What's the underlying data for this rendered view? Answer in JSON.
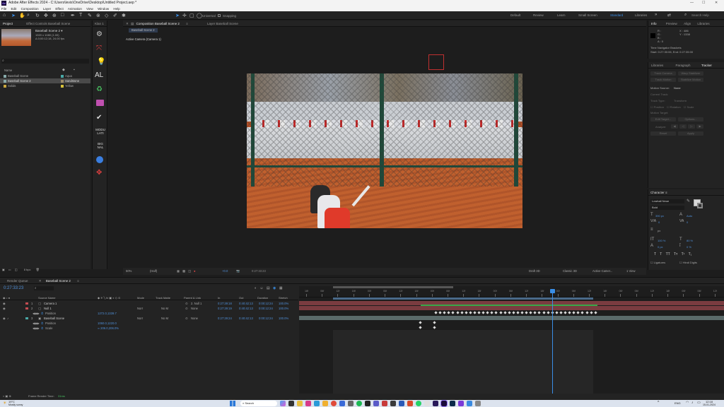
{
  "window": {
    "title": "Adobe After Effects 2024 - C:\\Users\\levis\\OneDrive\\Desktop\\Untitled Project.aep *",
    "app_badge": "Ae"
  },
  "menu": [
    "File",
    "Edit",
    "Composition",
    "Layer",
    "Effect",
    "Animation",
    "View",
    "Window",
    "Help"
  ],
  "toolbar": {
    "universal": "Universal",
    "snapping": "Snapping"
  },
  "workspaces": [
    "Default",
    "Review",
    "Learn",
    "Small Screen",
    "Standard",
    "Libraries"
  ],
  "search_help": "Search Help",
  "project": {
    "tabs": [
      "Project",
      "Effect Controls Baseball Scene"
    ],
    "selected_name": "Baseball Scene 2 ▾",
    "selected_info1": "1920 x 1080 (1.00)",
    "selected_info2": "Δ 0;00:12;18, 24.00 fps",
    "col_name": "Name",
    "items": [
      {
        "name": "Baseball Scene",
        "label": "Aqua",
        "color": "#4aa9a7"
      },
      {
        "name": "Baseball Scene 2",
        "label": "Sandstone",
        "color": "#9a8a6a"
      },
      {
        "name": "Solids",
        "label": "Yellow",
        "color": "#d8c23a"
      }
    ],
    "bpc": "8 bpc"
  },
  "effects_strip": {
    "tab": "Klan 1",
    "text1": "AL",
    "text2": "MODU\nLATI",
    "text3": "BIG\nNAL"
  },
  "composition": {
    "tab_comp": "Composition Baseball Scene 2",
    "tab_layer": "Layer Baseball Scene",
    "breadcrumb": "Baseball Scene 2",
    "camera_label": "Active Camera (Camera 1)",
    "zoom": "50%",
    "resolution": "(Half)",
    "exposure": "+0.0",
    "timecode": "0:27:33:23",
    "draft3d": "Draft 3D",
    "renderer": "Classic 3D",
    "view_camera": "Active Camer...",
    "views": "1 View"
  },
  "info": {
    "tabs": [
      "Info",
      "Preview",
      "Align",
      "Libraries"
    ],
    "r": "R :",
    "g": "G :",
    "b": "B :",
    "a": "A : 0",
    "x": "X : 486",
    "y": "Y : 1338",
    "note1": "Time Navigator Brackets",
    "note2": "Start: 0:27:30:06, End: 0:27:35:00"
  },
  "tracker": {
    "tabs": [
      "Libraries",
      "Paragraph",
      "Tracker"
    ],
    "buttons": [
      "Track Camera",
      "Warp Stabilizer",
      "Track Motion",
      "Stabilize Motion"
    ],
    "motion_source_label": "Motion Source:",
    "motion_source": "None",
    "current_track": "Current Track:",
    "track_type": "Track Type:",
    "track_type_val": "Transform",
    "options": [
      "Position",
      "Rotation",
      "Scale"
    ],
    "motion_target": "Motion Target:",
    "edit_target": "Edit Target...",
    "options_btn": "Options...",
    "analyze": "Analyze:",
    "reset": "Reset",
    "apply": "Apply"
  },
  "character": {
    "title": "Character",
    "font": "Lowball Neue",
    "style": "Bold",
    "size": "390 px",
    "leading": "Auto",
    "kerning": "0",
    "tracking": "0",
    "units": "px",
    "vscale": "100 %",
    "hscale": "80 %",
    "baseline": "0 px",
    "tsume": "0 %",
    "styles": [
      "T",
      "T",
      "TT",
      "Tᴛ",
      "T¹",
      "T₁"
    ],
    "ligatures": "Ligatures",
    "hindi": "Hindi Digits"
  },
  "timeline": {
    "tabs": [
      "Render Queue",
      "Baseball Scene 2"
    ],
    "current_time": "0:27:33:23",
    "col_source": "Source Name",
    "col_mode": "Mode",
    "col_trkmat": "Track Matte",
    "col_parent": "Parent & Link",
    "col_in": "In",
    "col_out": "Out",
    "col_duration": "Duration",
    "col_stretch": "Stretch",
    "layers": [
      {
        "num": "1",
        "name": "Camera 1",
        "color": "#c44c52",
        "mode": "",
        "matte": "",
        "parent": "2. Null 1",
        "in": "0:27:29:18",
        "out": "0:40:42:13",
        "dur": "0:00:12:24",
        "stretch": "100.0%"
      },
      {
        "num": "2",
        "name": "Null 1",
        "color": "#c44c52",
        "mode": "",
        "matte": "",
        "parent": "None",
        "in": "0:27:29:19",
        "out": "0:40:42:13",
        "dur": "0:00:12:24",
        "stretch": "100.0%"
      },
      {
        "num": "",
        "name": "Position",
        "value": "1272.0,1339.7"
      },
      {
        "num": "3",
        "name": "Baseball Scene",
        "color": "#4aa9a7",
        "mode": "Norr",
        "matte": "No M",
        "parent": "None",
        "in": "0:27:29:24",
        "out": "0:40:42:13",
        "dur": "0:00:12:24",
        "stretch": "100.0%"
      },
      {
        "num": "",
        "name": "Position",
        "value": "1060.0,1220.0"
      },
      {
        "num": "",
        "name": "Scale",
        "value": "∞ 206.0,206.0%"
      }
    ],
    "mode_top": "Norr",
    "matte_top": "No M",
    "ruler": [
      "18f",
      "06f",
      "12f",
      "18f",
      "00f",
      "06f",
      "12f",
      "18f",
      "00f",
      "06f",
      "12f",
      "18f",
      "00f",
      "06f",
      "12f",
      "18f",
      "00f",
      "06f",
      "12f",
      "18f",
      "00f",
      "06f",
      "12f",
      "18f",
      "00f",
      "06f",
      "12f"
    ],
    "frame_render_label": "Frame Render Time:",
    "frame_render_value": "31ms"
  },
  "taskbar": {
    "weather_temp": "19°C",
    "weather_desc": "Mostly sunny",
    "search": "Search",
    "lang": "ENG",
    "time": "12:18",
    "date": "15-01-2024"
  },
  "colors": {
    "accent": "#3a8ee6",
    "blue_value": "#4f8fd8",
    "dark_bg": "#1d1d1d",
    "taskbar": "#dce3ee"
  }
}
